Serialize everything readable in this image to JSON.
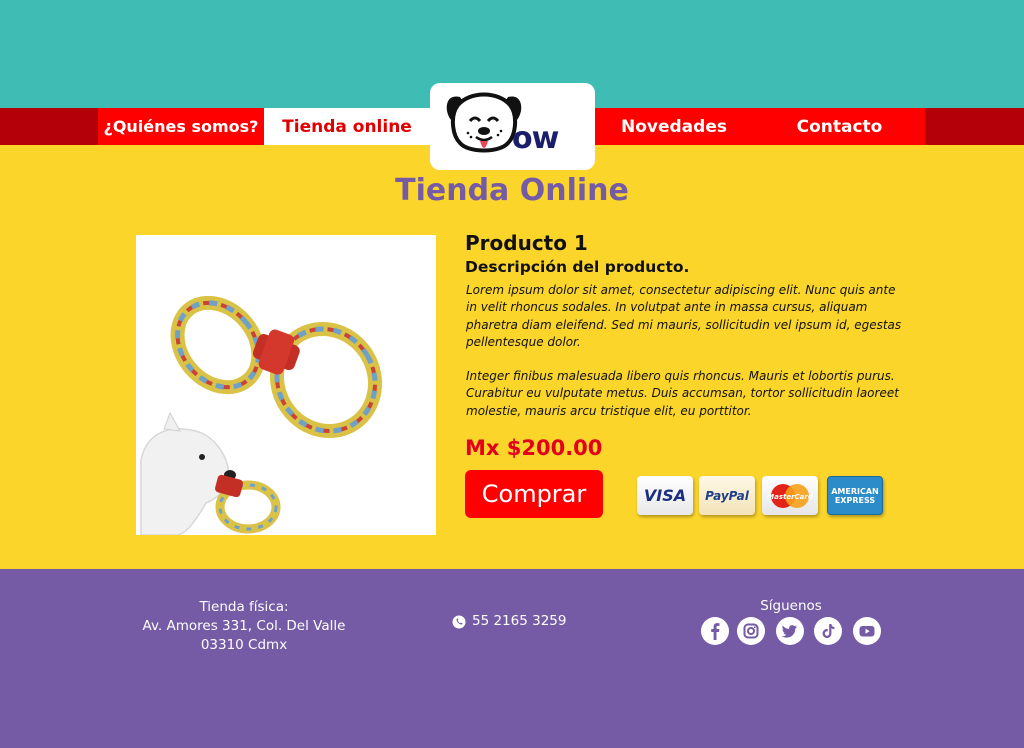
{
  "nav": {
    "items": [
      {
        "label": "¿Quiénes somos?"
      },
      {
        "label": "Tienda online"
      },
      {
        "label": "Novedades"
      },
      {
        "label": "Contacto"
      }
    ]
  },
  "logo": {
    "text": "ow"
  },
  "page": {
    "title": "Tienda Online"
  },
  "product": {
    "name": "Producto 1",
    "subtitle": "Descripción del producto.",
    "description_1": "Lorem ipsum dolor sit amet, consectetur adipiscing elit. Nunc quis ante in velit rhoncus sodales. In volutpat ante in massa cursus, aliquam pharetra diam eleifend. Sed mi mauris, sollicitudin vel ipsum id, egestas pellentesque dolor.",
    "description_2": "Integer finibus malesuada libero quis rhoncus. Mauris et lobortis purus. Curabitur eu vulputate metus. Duis accumsan, tortor sollicitudin laoreet molestie, mauris arcu tristique elit, eu porttitor.",
    "price": "Mx $200.00",
    "buy_label": "Comprar"
  },
  "payment": {
    "visa": "VISA",
    "paypal": "PayPal",
    "mastercard": "MasterCard",
    "amex_line1": "AMERICAN",
    "amex_line2": "EXPRESS"
  },
  "footer": {
    "store_label": "Tienda física:",
    "address_line1": "Av. Amores 331, Col. Del Valle",
    "address_line2": "03310 Cdmx",
    "phone": "55 2165 3259",
    "follow_label": "Síguenos",
    "social": [
      "facebook-icon",
      "instagram-icon",
      "twitter-icon",
      "tiktok-icon",
      "youtube-icon"
    ]
  },
  "colors": {
    "teal": "#3FBDB5",
    "red": "#FF0000",
    "dark_red": "#B30009",
    "yellow": "#FCD52B",
    "purple": "#755AA6"
  }
}
